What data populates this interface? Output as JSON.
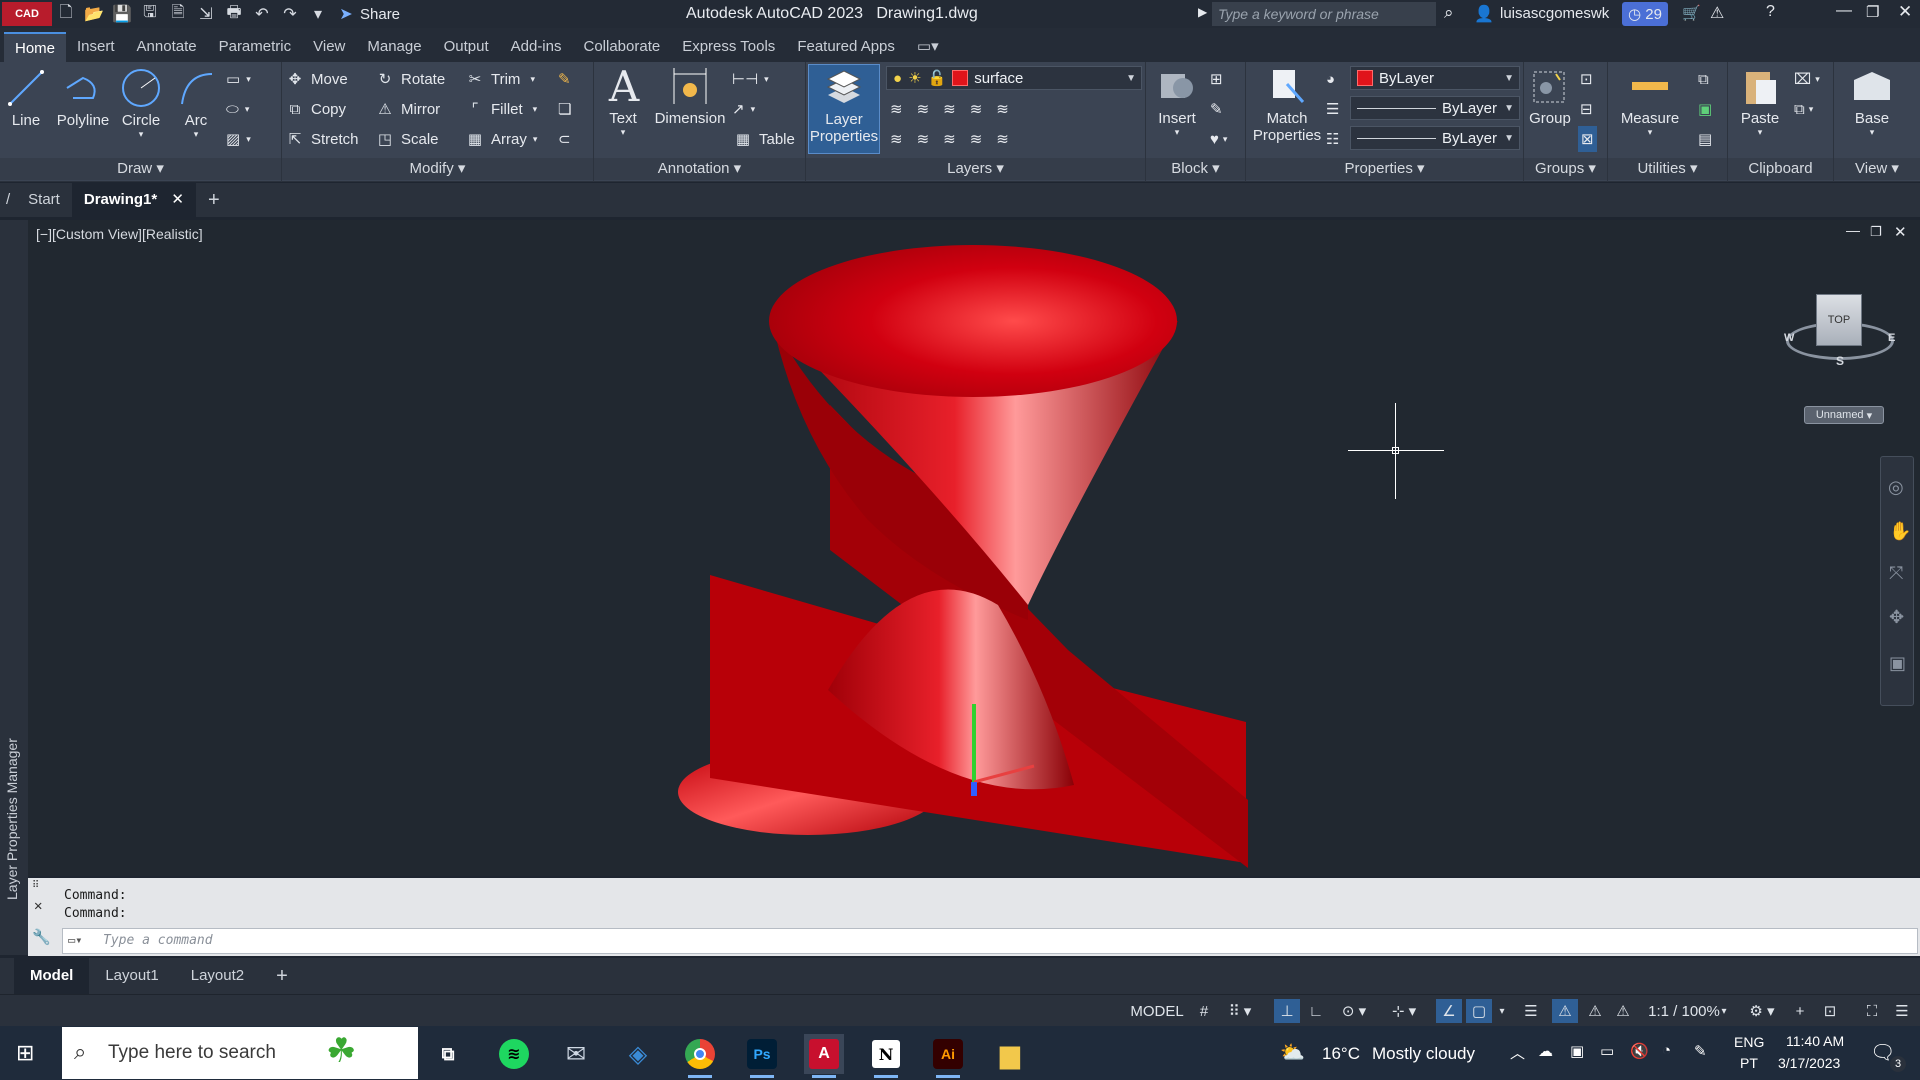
{
  "title_bar": {
    "app_badge": "CAD",
    "share_label": "Share",
    "app_name": "Autodesk AutoCAD 2023",
    "file_name": "Drawing1.dwg",
    "search_placeholder": "Type a keyword or phrase",
    "username": "luisascgomeswk",
    "notifications_count": "29"
  },
  "ribbon_tabs": [
    "Home",
    "Insert",
    "Annotate",
    "Parametric",
    "View",
    "Manage",
    "Output",
    "Add-ins",
    "Collaborate",
    "Express Tools",
    "Featured Apps"
  ],
  "panels": {
    "draw": {
      "title": "Draw",
      "line": "Line",
      "polyline": "Polyline",
      "circle": "Circle",
      "arc": "Arc"
    },
    "modify": {
      "title": "Modify",
      "move": "Move",
      "rotate": "Rotate",
      "trim": "Trim",
      "copy": "Copy",
      "mirror": "Mirror",
      "fillet": "Fillet",
      "stretch": "Stretch",
      "scale": "Scale",
      "array": "Array"
    },
    "annotation": {
      "title": "Annotation",
      "text": "Text",
      "dimension": "Dimension",
      "table": "Table"
    },
    "layers": {
      "title": "Layers",
      "layer_properties_l1": "Layer",
      "layer_properties_l2": "Properties",
      "current_layer": "surface"
    },
    "block": {
      "title": "Block",
      "insert": "Insert"
    },
    "properties": {
      "title": "Properties",
      "match_l1": "Match",
      "match_l2": "Properties",
      "color": "ByLayer",
      "linetype": "ByLayer",
      "lineweight": "ByLayer"
    },
    "groups": {
      "title": "Groups",
      "group": "Group"
    },
    "utilities": {
      "title": "Utilities",
      "measure": "Measure"
    },
    "clipboard": {
      "title": "Clipboard",
      "paste": "Paste"
    },
    "view": {
      "title": "View",
      "base": "Base"
    }
  },
  "file_tabs": {
    "start": "Start",
    "drawing": "Drawing1*"
  },
  "viewport": {
    "label": "[−][Custom View][Realistic]",
    "viewcube_face": "TOP",
    "compass_w": "W",
    "compass_e": "E",
    "compass_s": "S",
    "ucs_name": "Unnamed"
  },
  "side_palette": {
    "label": "Layer Properties Manager"
  },
  "command": {
    "history": [
      "Command:",
      "Command:"
    ],
    "placeholder": "Type a command"
  },
  "layout_tabs": [
    "Model",
    "Layout1",
    "Layout2"
  ],
  "status_bar": {
    "model": "MODEL",
    "scale": "1:1 / 100%"
  },
  "taskbar": {
    "search_placeholder": "Type here to search",
    "weather_temp": "16°C",
    "weather_desc": "Mostly cloudy",
    "lang_1": "ENG",
    "lang_2": "PT",
    "time": "11:40 AM",
    "date": "3/17/2023",
    "notif_count": "3"
  },
  "colors": {
    "accent": "#2f5f95",
    "surface_red": "#c4000c",
    "ribbon_bg": "#3b4453",
    "canvas_bg": "#212830"
  }
}
